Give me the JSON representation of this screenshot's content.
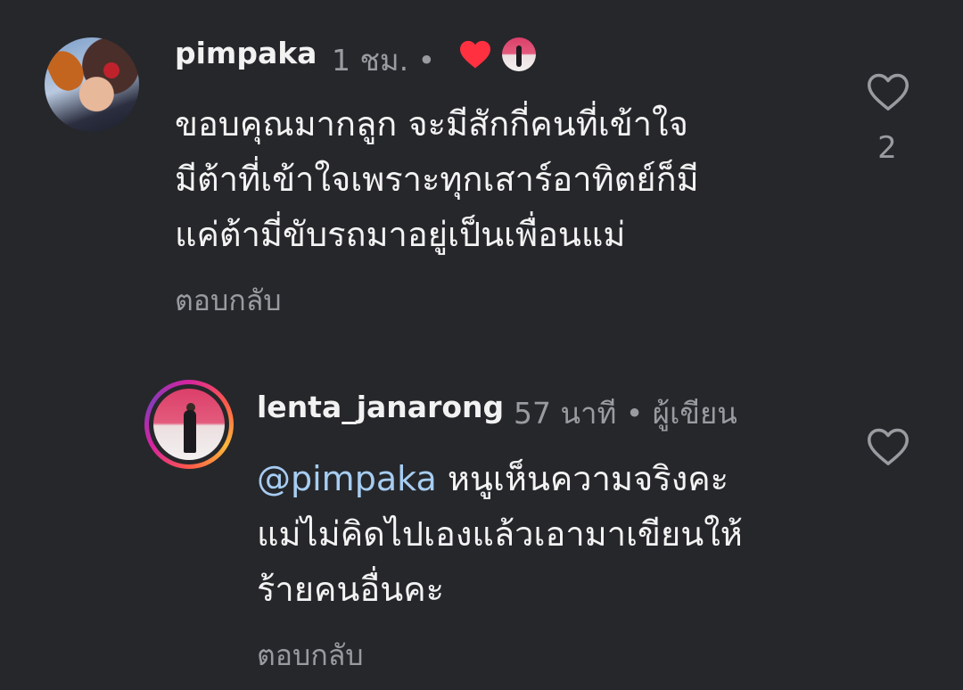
{
  "comments": [
    {
      "username": "pimpaka",
      "time": "1 ชม.",
      "separator": "•",
      "body": "ขอบคุณมากลูก จะมีสักกี่คนที่เข้าใจ\nมีต้าที่เข้าใจเพราะทุกเสาร์อาทิตย์ก็มี\nแค่ต้ามี่ขับรถมาอยู่เป็นเพื่อนแม่",
      "reply_label": "ตอบกลับ",
      "like_count": "2",
      "liked_by_author_icon": "heart-filled-icon"
    },
    {
      "username": "lenta_janarong",
      "time": "57 นาที",
      "separator": "•",
      "badge": "ผู้เขียน",
      "mention": "@pimpaka",
      "body": "หนูเห็นความจริงคะ\nแม่ไม่คิดไปเองแล้วเอามาเขียนให้\nร้ายคนอื่นคะ",
      "reply_label": "ตอบกลับ"
    }
  ],
  "colors": {
    "background": "#26272b",
    "text": "#f3f3f3",
    "muted": "#9a9ba0",
    "mention": "#a7cdf2",
    "like_red": "#ff3040"
  }
}
